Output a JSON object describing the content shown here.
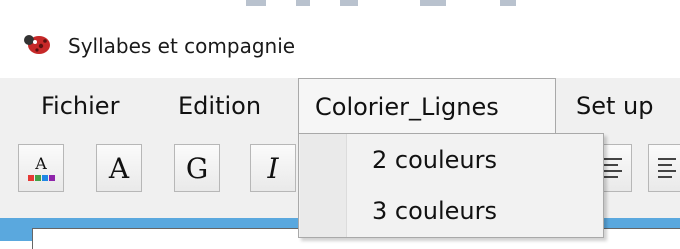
{
  "window": {
    "title": "Syllabes et compagnie",
    "icon": "ladybug-icon"
  },
  "menubar": {
    "items": [
      {
        "label": "Fichier",
        "active": false
      },
      {
        "label": "Edition",
        "active": false
      },
      {
        "label": "Colorier_Lignes",
        "active": true
      },
      {
        "label": "Set up",
        "active": false
      }
    ]
  },
  "toolbar": {
    "buttons": [
      {
        "label": "A",
        "name": "text-color-icon"
      },
      {
        "label": "A",
        "name": "font-icon"
      },
      {
        "label": "G",
        "name": "bold-icon"
      },
      {
        "label": "I",
        "name": "italic-icon"
      },
      {
        "label": "",
        "name": "align-left-icon"
      },
      {
        "label": "",
        "name": "align-center-icon"
      }
    ],
    "color_swatches": [
      "#e53935",
      "#43a047",
      "#1e88e5",
      "#8e24aa"
    ]
  },
  "dropdown": {
    "items": [
      {
        "label": "2 couleurs"
      },
      {
        "label": "3 couleurs"
      }
    ]
  },
  "colors": {
    "accent": "#5aa8de",
    "menubar_bg": "#f0f0f0",
    "ladybug": "#c62828"
  }
}
